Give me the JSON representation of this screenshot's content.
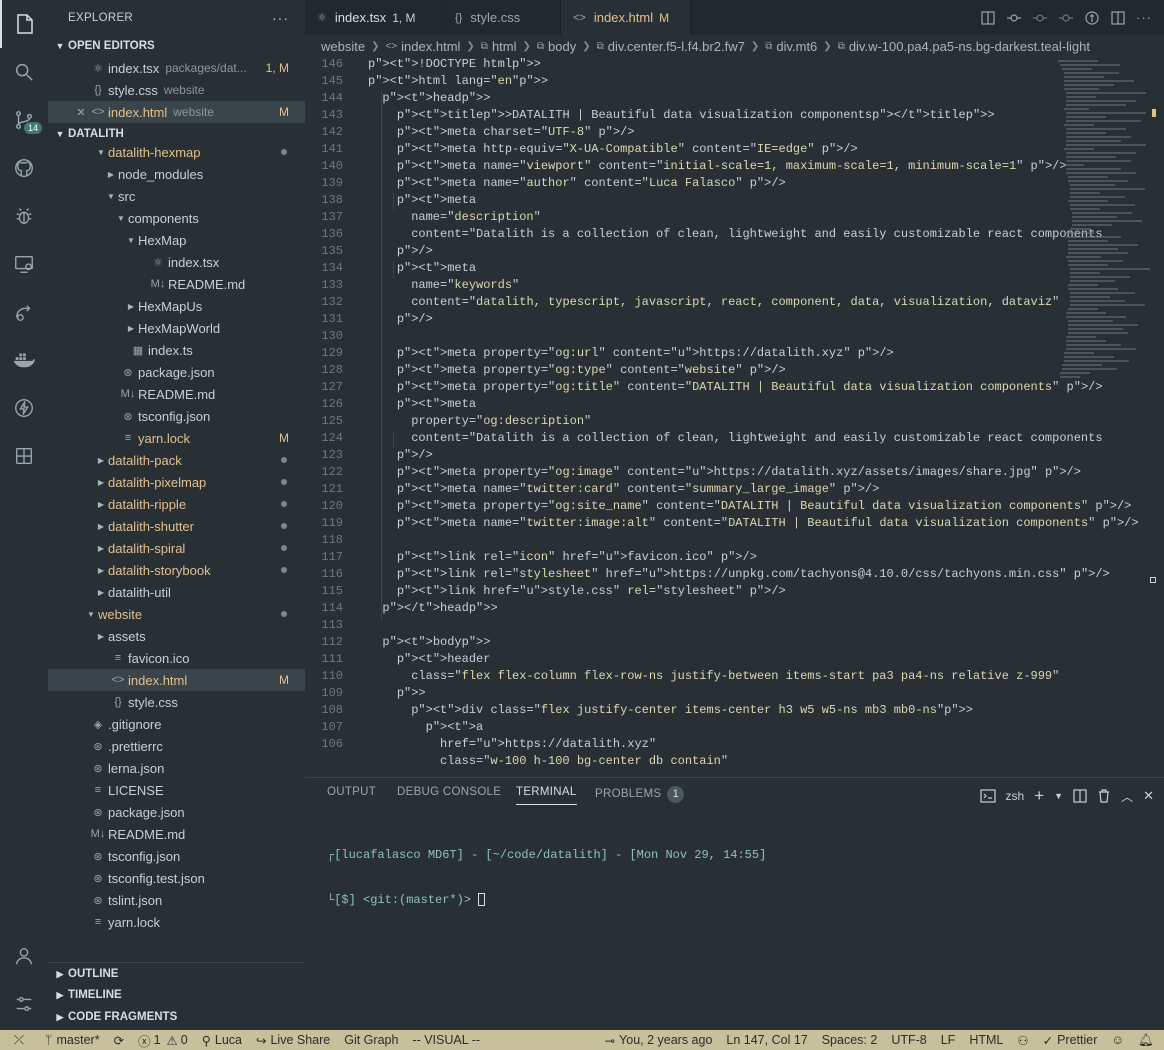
{
  "activity": {
    "scm_badge": "14"
  },
  "explorer": {
    "title": "EXPLORER",
    "more": "···",
    "open_editors": {
      "label": "OPEN EDITORS",
      "items": [
        {
          "name": "index.tsx",
          "desc": "packages/dat...",
          "status": "1, M"
        },
        {
          "name": "style.css",
          "desc": "website",
          "status": ""
        },
        {
          "name": "index.html",
          "desc": "website",
          "status": "M"
        }
      ]
    },
    "project": "DATALITH",
    "tree": [
      {
        "label": "datalith-hexmap"
      },
      {
        "label": "node_modules"
      },
      {
        "label": "src"
      },
      {
        "label": "components"
      },
      {
        "label": "HexMap"
      },
      {
        "label": "index.tsx"
      },
      {
        "label": "README.md"
      },
      {
        "label": "HexMapUs"
      },
      {
        "label": "HexMapWorld"
      },
      {
        "label": "index.ts"
      },
      {
        "label": "package.json"
      },
      {
        "label": "README.md"
      },
      {
        "label": "tsconfig.json"
      },
      {
        "label": "yarn.lock",
        "status": "M"
      },
      {
        "label": "datalith-pack"
      },
      {
        "label": "datalith-pixelmap"
      },
      {
        "label": "datalith-ripple"
      },
      {
        "label": "datalith-shutter"
      },
      {
        "label": "datalith-spiral"
      },
      {
        "label": "datalith-storybook"
      },
      {
        "label": "datalith-util"
      },
      {
        "label": "website"
      },
      {
        "label": "assets"
      },
      {
        "label": "favicon.ico"
      },
      {
        "label": "index.html",
        "status": "M"
      },
      {
        "label": "style.css"
      },
      {
        "label": ".gitignore"
      },
      {
        "label": ".prettierrc"
      },
      {
        "label": "lerna.json"
      },
      {
        "label": "LICENSE"
      },
      {
        "label": "package.json"
      },
      {
        "label": "README.md"
      },
      {
        "label": "tsconfig.json"
      },
      {
        "label": "tsconfig.test.json"
      },
      {
        "label": "tslint.json"
      },
      {
        "label": "yarn.lock"
      }
    ],
    "outline": "OUTLINE",
    "timeline": "TIMELINE",
    "code_fragments": "CODE FRAGMENTS"
  },
  "tabs": [
    {
      "name": "index.tsx",
      "status": "1, M"
    },
    {
      "name": "style.css",
      "status": ""
    },
    {
      "name": "index.html",
      "status": "M"
    }
  ],
  "breadcrumb": [
    "website",
    "index.html",
    "html",
    "body",
    "div.center.f5-l.f4.br2.fw7",
    "div.mt6",
    "div.w-100.pa4.pa5-ns.bg-darkest.teal-light"
  ],
  "code": {
    "line_numbers": [
      "146",
      "145",
      "144",
      "143",
      "142",
      "141",
      "140",
      "139",
      "138",
      "137",
      "136",
      "135",
      "134",
      "133",
      "132",
      "131",
      "130",
      "129",
      "128",
      "127",
      "126",
      "125",
      "124",
      "123",
      "122",
      "121",
      "120",
      "119",
      "118",
      "117",
      "116",
      "115",
      "114",
      "113",
      "112",
      "111",
      "110",
      "109",
      "108",
      "107",
      "106"
    ],
    "lines": [
      "<!DOCTYPE html>",
      "<html lang=\"en\">",
      "  <head>",
      "    <title>DATALITH | Beautiful data visualization components</title>",
      "    <meta charset=\"UTF-8\" />",
      "    <meta http-equiv=\"X-UA-Compatible\" content=\"IE=edge\" />",
      "    <meta name=\"viewport\" content=\"initial-scale=1, maximum-scale=1, minimum-scale=1\" />",
      "    <meta name=\"author\" content=\"Luca Falasco\" />",
      "    <meta",
      "      name=\"description\"",
      "      content=\"Datalith is a collection of clean, lightweight and easily customizable react components",
      "    />",
      "    <meta",
      "      name=\"keywords\"",
      "      content=\"datalith, typescript, javascript, react, component, data, visualization, dataviz\"",
      "    />",
      "",
      "    <meta property=\"og:url\" content=\"https://datalith.xyz\" />",
      "    <meta property=\"og:type\" content=\"website\" />",
      "    <meta property=\"og:title\" content=\"DATALITH | Beautiful data visualization components\" />",
      "    <meta",
      "      property=\"og:description\"",
      "      content=\"Datalith is a collection of clean, lightweight and easily customizable react components",
      "    />",
      "    <meta property=\"og:image\" content=\"https://datalith.xyz/assets/images/share.jpg\" />",
      "    <meta name=\"twitter:card\" content=\"summary_large_image\" />",
      "    <meta property=\"og:site_name\" content=\"DATALITH | Beautiful data visualization components\" />",
      "    <meta name=\"twitter:image:alt\" content=\"DATALITH | Beautiful data visualization components\" />",
      "",
      "    <link rel=\"icon\" href=\"favicon.ico\" />",
      "    <link rel=\"stylesheet\" href=\"https://unpkg.com/tachyons@4.10.0/css/tachyons.min.css\" />",
      "    <link href=\"style.css\" rel=\"stylesheet\" />",
      "  </head>",
      "",
      "  <body>",
      "    <header",
      "      class=\"flex flex-column flex-row-ns justify-between items-start pa3 pa4-ns relative z-999\"",
      "    >",
      "      <div class=\"flex justify-center items-center h3 w5 w5-ns mb3 mb0-ns\">",
      "        <a",
      "          href=\"https://datalith.xyz\"",
      "          class=\"w-100 h-100 bg-center db contain\""
    ]
  },
  "panel": {
    "tabs": [
      "OUTPUT",
      "DEBUG CONSOLE",
      "TERMINAL",
      "PROBLEMS"
    ],
    "problems_count": "1",
    "shell": "zsh",
    "terminal_line1": "[lucafalasco MD6T] - [~/code/datalith] - [Mon Nov 29, 14:55]",
    "terminal_line2": "[$] <git:(master*)> "
  },
  "status": {
    "branch": "master*",
    "errors": "1",
    "warnings": "0",
    "user": "Luca",
    "live_share": "Live Share",
    "git_graph": "Git Graph",
    "mode": "-- VISUAL --",
    "blame": "You, 2 years ago",
    "position": "Ln 147, Col 17",
    "spaces": "Spaces: 2",
    "encoding": "UTF-8",
    "eol": "LF",
    "language": "HTML",
    "prettier": "Prettier"
  }
}
